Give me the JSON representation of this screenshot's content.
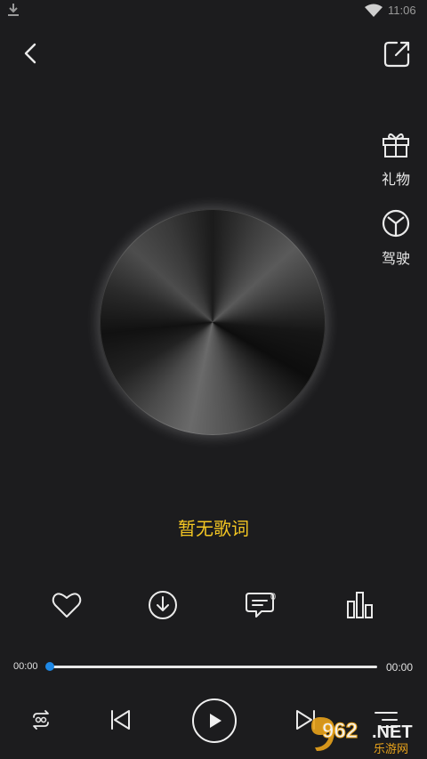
{
  "status_bar": {
    "time": "11:06",
    "icons": [
      "download-icon",
      "wifi-icon"
    ]
  },
  "top_bar": {
    "back_icon": "chevron-left-icon",
    "share_icon": "share-icon"
  },
  "side_actions": [
    {
      "icon": "gift-icon",
      "label": "礼物"
    },
    {
      "icon": "steering-wheel-icon",
      "label": "驾驶"
    }
  ],
  "lyrics": {
    "text": "暂无歌词"
  },
  "actions": {
    "like_icon": "heart-icon",
    "download_icon": "download-circle-icon",
    "comment_icon": "comment-icon",
    "comment_count": "0",
    "equalizer_icon": "equalizer-icon"
  },
  "progress": {
    "current": "00:00",
    "total": "00:00",
    "value": 0,
    "accent_color": "#1e88e5"
  },
  "controls": {
    "mode_icon": "loop-icon",
    "prev_icon": "previous-icon",
    "play_icon": "play-icon",
    "next_icon": "next-icon",
    "playlist_icon": "playlist-icon"
  },
  "watermark": {
    "brand": "962.NET",
    "subtitle": "乐游网"
  },
  "colors": {
    "background": "#1c1c1e",
    "lyrics": "#f3c623"
  }
}
